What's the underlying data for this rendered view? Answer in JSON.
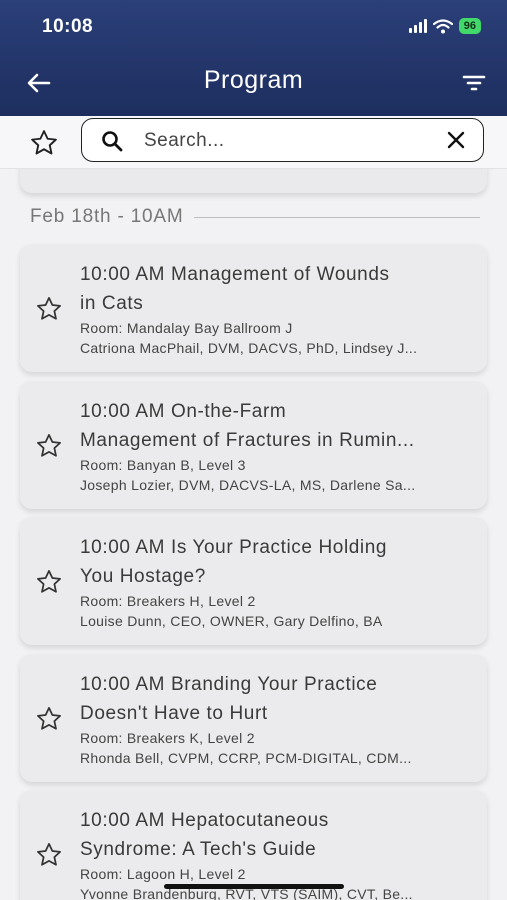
{
  "status": {
    "time": "10:08",
    "battery": "96"
  },
  "header": {
    "title": "Program"
  },
  "search": {
    "placeholder": "Search...",
    "value": ""
  },
  "section": {
    "label": "Feb 18th - 10AM"
  },
  "sessions": [
    {
      "title_line1": "10:00 AM Management of Wounds",
      "title_line2": "in Cats",
      "room": "Room: Mandalay Bay Ballroom J",
      "speakers": "Catriona MacPhail, DVM, DACVS, PhD, Lindsey J..."
    },
    {
      "title_line1": "10:00 AM On-the-Farm",
      "title_line2": "Management of Fractures in Rumin...",
      "room": "Room: Banyan B, Level 3",
      "speakers": "Joseph Lozier, DVM, DACVS-LA, MS, Darlene Sa..."
    },
    {
      "title_line1": "10:00 AM Is Your Practice Holding",
      "title_line2": "You Hostage?",
      "room": "Room: Breakers H, Level 2",
      "speakers": "Louise Dunn, CEO, OWNER, Gary Delfino, BA"
    },
    {
      "title_line1": "10:00 AM Branding Your Practice",
      "title_line2": "Doesn't Have to Hurt",
      "room": "Room: Breakers K, Level 2",
      "speakers": "Rhonda Bell, CVPM, CCRP, PCM-DIGITAL, CDM..."
    },
    {
      "title_line1": "10:00 AM Hepatocutaneous",
      "title_line2": "Syndrome: A Tech's Guide",
      "room": "Room: Lagoon H, Level 2",
      "speakers": "Yvonne Brandenburg, RVT, VTS (SAIM), CVT, Be..."
    }
  ]
}
